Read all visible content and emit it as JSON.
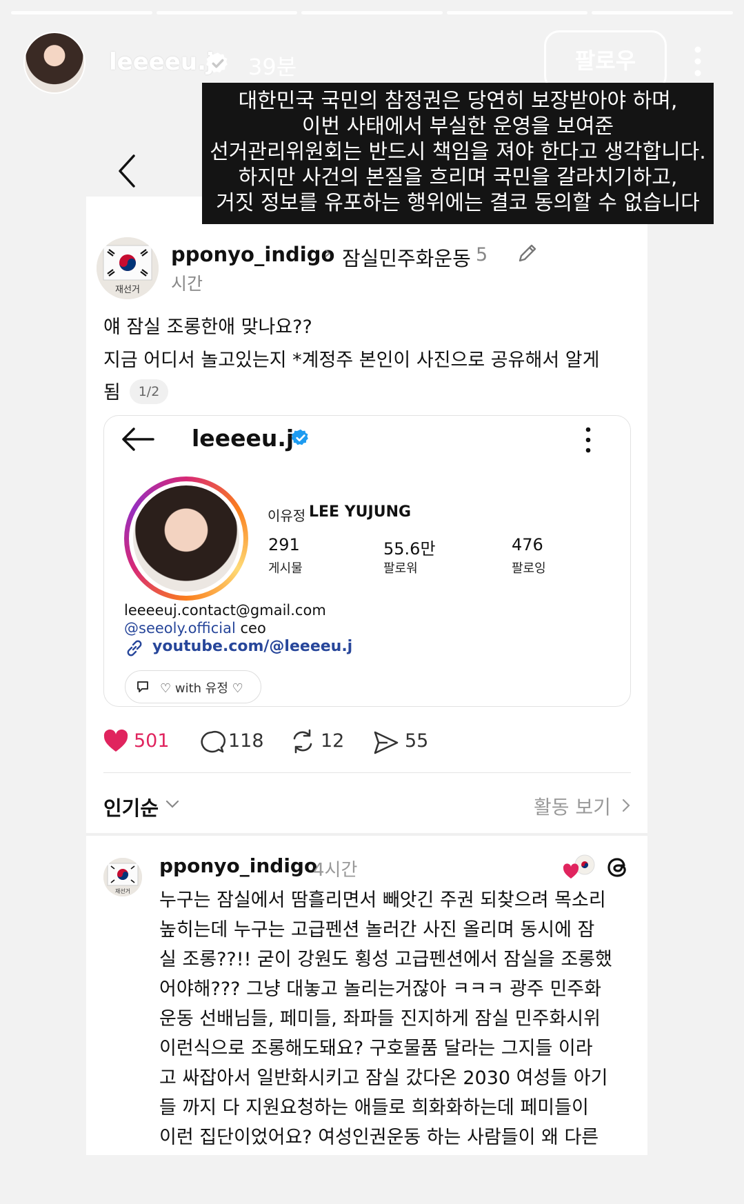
{
  "story": {
    "username": "leeeeu.j",
    "time": "39분",
    "follow_label": "팔로우",
    "caption_lines": [
      "대한민국 국민의 참정권은 당연히 보장받아야 하며,",
      "이번 사태에서 부실한 운영을 보여준",
      "선거관리위원회는 반드시 책임을 져야 한다고 생각합니다.",
      "하지만 사건의 본질을 흐리며 국민을 갈라치기하고,",
      "거짓 정보를 유포하는 행위에는 결코 동의할 수 없습니다"
    ]
  },
  "post": {
    "username": "pponyo_indigo",
    "topic": "잠실민주화운동",
    "time_num": "5",
    "time_unit": "시간",
    "avatar_text": "재선거",
    "text_lines": [
      "얘 잠실 조롱한애 맞나요??",
      "지금 어디서 놀고있는지 *계정주 본인이 사진으로 공유해서 알게",
      "됨"
    ],
    "page_indicator": "1/2"
  },
  "screenshot": {
    "username": "leeeeu.j",
    "name_kr": "이유정",
    "name_en": "LEE YUJUNG",
    "stats": [
      {
        "value": "291",
        "label": "게시물"
      },
      {
        "value": "55.6만",
        "label": "팔로워"
      },
      {
        "value": "476",
        "label": "팔로잉"
      }
    ],
    "email": "leeeeuj.contact@gmail.com",
    "handle": "@seeoly.official",
    "handle_suffix": " ceo",
    "youtube": "youtube.com/@leeeeu.j",
    "threads_label": "♡ with 유정 ♡"
  },
  "actions": {
    "likes": "501",
    "comments": "118",
    "reposts": "12",
    "shares": "55"
  },
  "sort": {
    "label": "인기순",
    "activity_label": "활동 보기"
  },
  "reply": {
    "username": "pponyo_indigo",
    "time": "4시간",
    "lines": [
      "누구는 잠실에서 땀흘리면서 빼앗긴 주권 되찾으려 목소리",
      "높히는데 누구는 고급펜션 놀러간 사진 올리며 동시에 잠",
      "실 조롱??!! 굳이 강원도 횡성 고급펜션에서 잠실을 조롱했",
      "어야해??? 그냥 대놓고 놀리는거잖아 ㅋㅋㅋ 광주 민주화",
      "운동 선배님들, 페미들, 좌파들 진지하게 잠실 민주화시위",
      "이런식으로 조롱해도돼요? 구호물품 달라는 그지들 이라",
      "고 싸잡아서 일반화시키고 잠실 갔다온 2030 여성들 아기",
      "들 까지 다 지원요청하는 애들로 희화화하는데 페미들이",
      "이런 집단이었어요? 여성인권운동 하는 사람들이 왜 다른"
    ]
  },
  "colors": {
    "like": "#e0245e",
    "verified": "#1d9bf0",
    "link": "#27469a"
  }
}
